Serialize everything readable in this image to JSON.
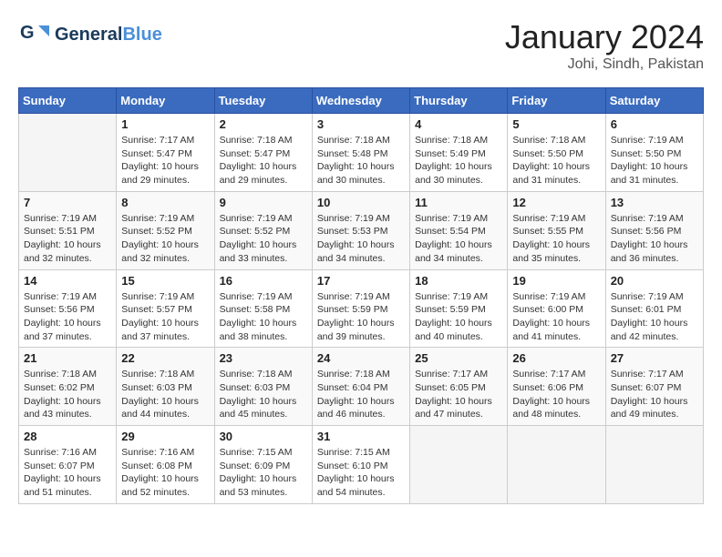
{
  "header": {
    "logo_line1": "General",
    "logo_line2": "Blue",
    "month": "January 2024",
    "location": "Johi, Sindh, Pakistan"
  },
  "weekdays": [
    "Sunday",
    "Monday",
    "Tuesday",
    "Wednesday",
    "Thursday",
    "Friday",
    "Saturday"
  ],
  "weeks": [
    [
      {
        "day": "",
        "info": ""
      },
      {
        "day": "1",
        "info": "Sunrise: 7:17 AM\nSunset: 5:47 PM\nDaylight: 10 hours\nand 29 minutes."
      },
      {
        "day": "2",
        "info": "Sunrise: 7:18 AM\nSunset: 5:47 PM\nDaylight: 10 hours\nand 29 minutes."
      },
      {
        "day": "3",
        "info": "Sunrise: 7:18 AM\nSunset: 5:48 PM\nDaylight: 10 hours\nand 30 minutes."
      },
      {
        "day": "4",
        "info": "Sunrise: 7:18 AM\nSunset: 5:49 PM\nDaylight: 10 hours\nand 30 minutes."
      },
      {
        "day": "5",
        "info": "Sunrise: 7:18 AM\nSunset: 5:50 PM\nDaylight: 10 hours\nand 31 minutes."
      },
      {
        "day": "6",
        "info": "Sunrise: 7:19 AM\nSunset: 5:50 PM\nDaylight: 10 hours\nand 31 minutes."
      }
    ],
    [
      {
        "day": "7",
        "info": "Sunrise: 7:19 AM\nSunset: 5:51 PM\nDaylight: 10 hours\nand 32 minutes."
      },
      {
        "day": "8",
        "info": "Sunrise: 7:19 AM\nSunset: 5:52 PM\nDaylight: 10 hours\nand 32 minutes."
      },
      {
        "day": "9",
        "info": "Sunrise: 7:19 AM\nSunset: 5:52 PM\nDaylight: 10 hours\nand 33 minutes."
      },
      {
        "day": "10",
        "info": "Sunrise: 7:19 AM\nSunset: 5:53 PM\nDaylight: 10 hours\nand 34 minutes."
      },
      {
        "day": "11",
        "info": "Sunrise: 7:19 AM\nSunset: 5:54 PM\nDaylight: 10 hours\nand 34 minutes."
      },
      {
        "day": "12",
        "info": "Sunrise: 7:19 AM\nSunset: 5:55 PM\nDaylight: 10 hours\nand 35 minutes."
      },
      {
        "day": "13",
        "info": "Sunrise: 7:19 AM\nSunset: 5:56 PM\nDaylight: 10 hours\nand 36 minutes."
      }
    ],
    [
      {
        "day": "14",
        "info": "Sunrise: 7:19 AM\nSunset: 5:56 PM\nDaylight: 10 hours\nand 37 minutes."
      },
      {
        "day": "15",
        "info": "Sunrise: 7:19 AM\nSunset: 5:57 PM\nDaylight: 10 hours\nand 37 minutes."
      },
      {
        "day": "16",
        "info": "Sunrise: 7:19 AM\nSunset: 5:58 PM\nDaylight: 10 hours\nand 38 minutes."
      },
      {
        "day": "17",
        "info": "Sunrise: 7:19 AM\nSunset: 5:59 PM\nDaylight: 10 hours\nand 39 minutes."
      },
      {
        "day": "18",
        "info": "Sunrise: 7:19 AM\nSunset: 5:59 PM\nDaylight: 10 hours\nand 40 minutes."
      },
      {
        "day": "19",
        "info": "Sunrise: 7:19 AM\nSunset: 6:00 PM\nDaylight: 10 hours\nand 41 minutes."
      },
      {
        "day": "20",
        "info": "Sunrise: 7:19 AM\nSunset: 6:01 PM\nDaylight: 10 hours\nand 42 minutes."
      }
    ],
    [
      {
        "day": "21",
        "info": "Sunrise: 7:18 AM\nSunset: 6:02 PM\nDaylight: 10 hours\nand 43 minutes."
      },
      {
        "day": "22",
        "info": "Sunrise: 7:18 AM\nSunset: 6:03 PM\nDaylight: 10 hours\nand 44 minutes."
      },
      {
        "day": "23",
        "info": "Sunrise: 7:18 AM\nSunset: 6:03 PM\nDaylight: 10 hours\nand 45 minutes."
      },
      {
        "day": "24",
        "info": "Sunrise: 7:18 AM\nSunset: 6:04 PM\nDaylight: 10 hours\nand 46 minutes."
      },
      {
        "day": "25",
        "info": "Sunrise: 7:17 AM\nSunset: 6:05 PM\nDaylight: 10 hours\nand 47 minutes."
      },
      {
        "day": "26",
        "info": "Sunrise: 7:17 AM\nSunset: 6:06 PM\nDaylight: 10 hours\nand 48 minutes."
      },
      {
        "day": "27",
        "info": "Sunrise: 7:17 AM\nSunset: 6:07 PM\nDaylight: 10 hours\nand 49 minutes."
      }
    ],
    [
      {
        "day": "28",
        "info": "Sunrise: 7:16 AM\nSunset: 6:07 PM\nDaylight: 10 hours\nand 51 minutes."
      },
      {
        "day": "29",
        "info": "Sunrise: 7:16 AM\nSunset: 6:08 PM\nDaylight: 10 hours\nand 52 minutes."
      },
      {
        "day": "30",
        "info": "Sunrise: 7:15 AM\nSunset: 6:09 PM\nDaylight: 10 hours\nand 53 minutes."
      },
      {
        "day": "31",
        "info": "Sunrise: 7:15 AM\nSunset: 6:10 PM\nDaylight: 10 hours\nand 54 minutes."
      },
      {
        "day": "",
        "info": ""
      },
      {
        "day": "",
        "info": ""
      },
      {
        "day": "",
        "info": ""
      }
    ]
  ]
}
